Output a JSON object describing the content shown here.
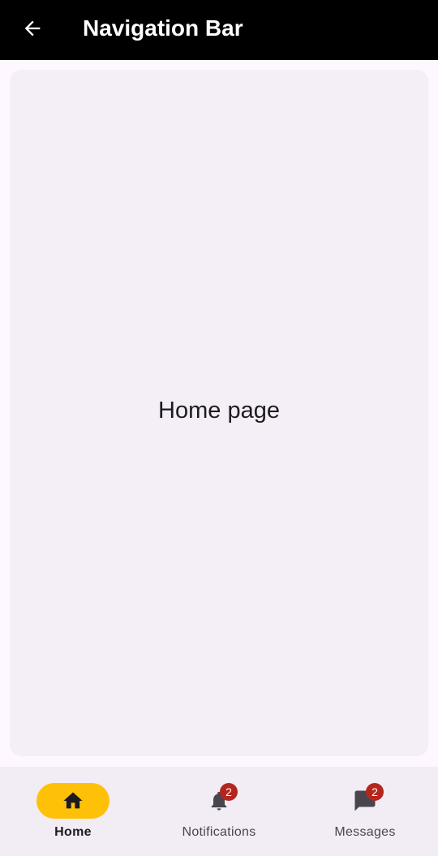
{
  "app_bar": {
    "title": "Navigation Bar",
    "back_icon": "arrow-back-icon"
  },
  "main": {
    "text": "Home page"
  },
  "nav": {
    "items": [
      {
        "label": "Home",
        "icon": "home-icon",
        "selected": true
      },
      {
        "label": "Notifications",
        "icon": "bell-icon",
        "badge": "2"
      },
      {
        "label": "Messages",
        "icon": "message-icon",
        "badge": "2"
      }
    ]
  },
  "colors": {
    "app_bar_bg": "#000000",
    "page_bg": "#fef7ff",
    "card_bg": "#f4eff7",
    "nav_bg": "#f2ecf4",
    "indicator": "#ffc107",
    "badge": "#b3261e"
  }
}
